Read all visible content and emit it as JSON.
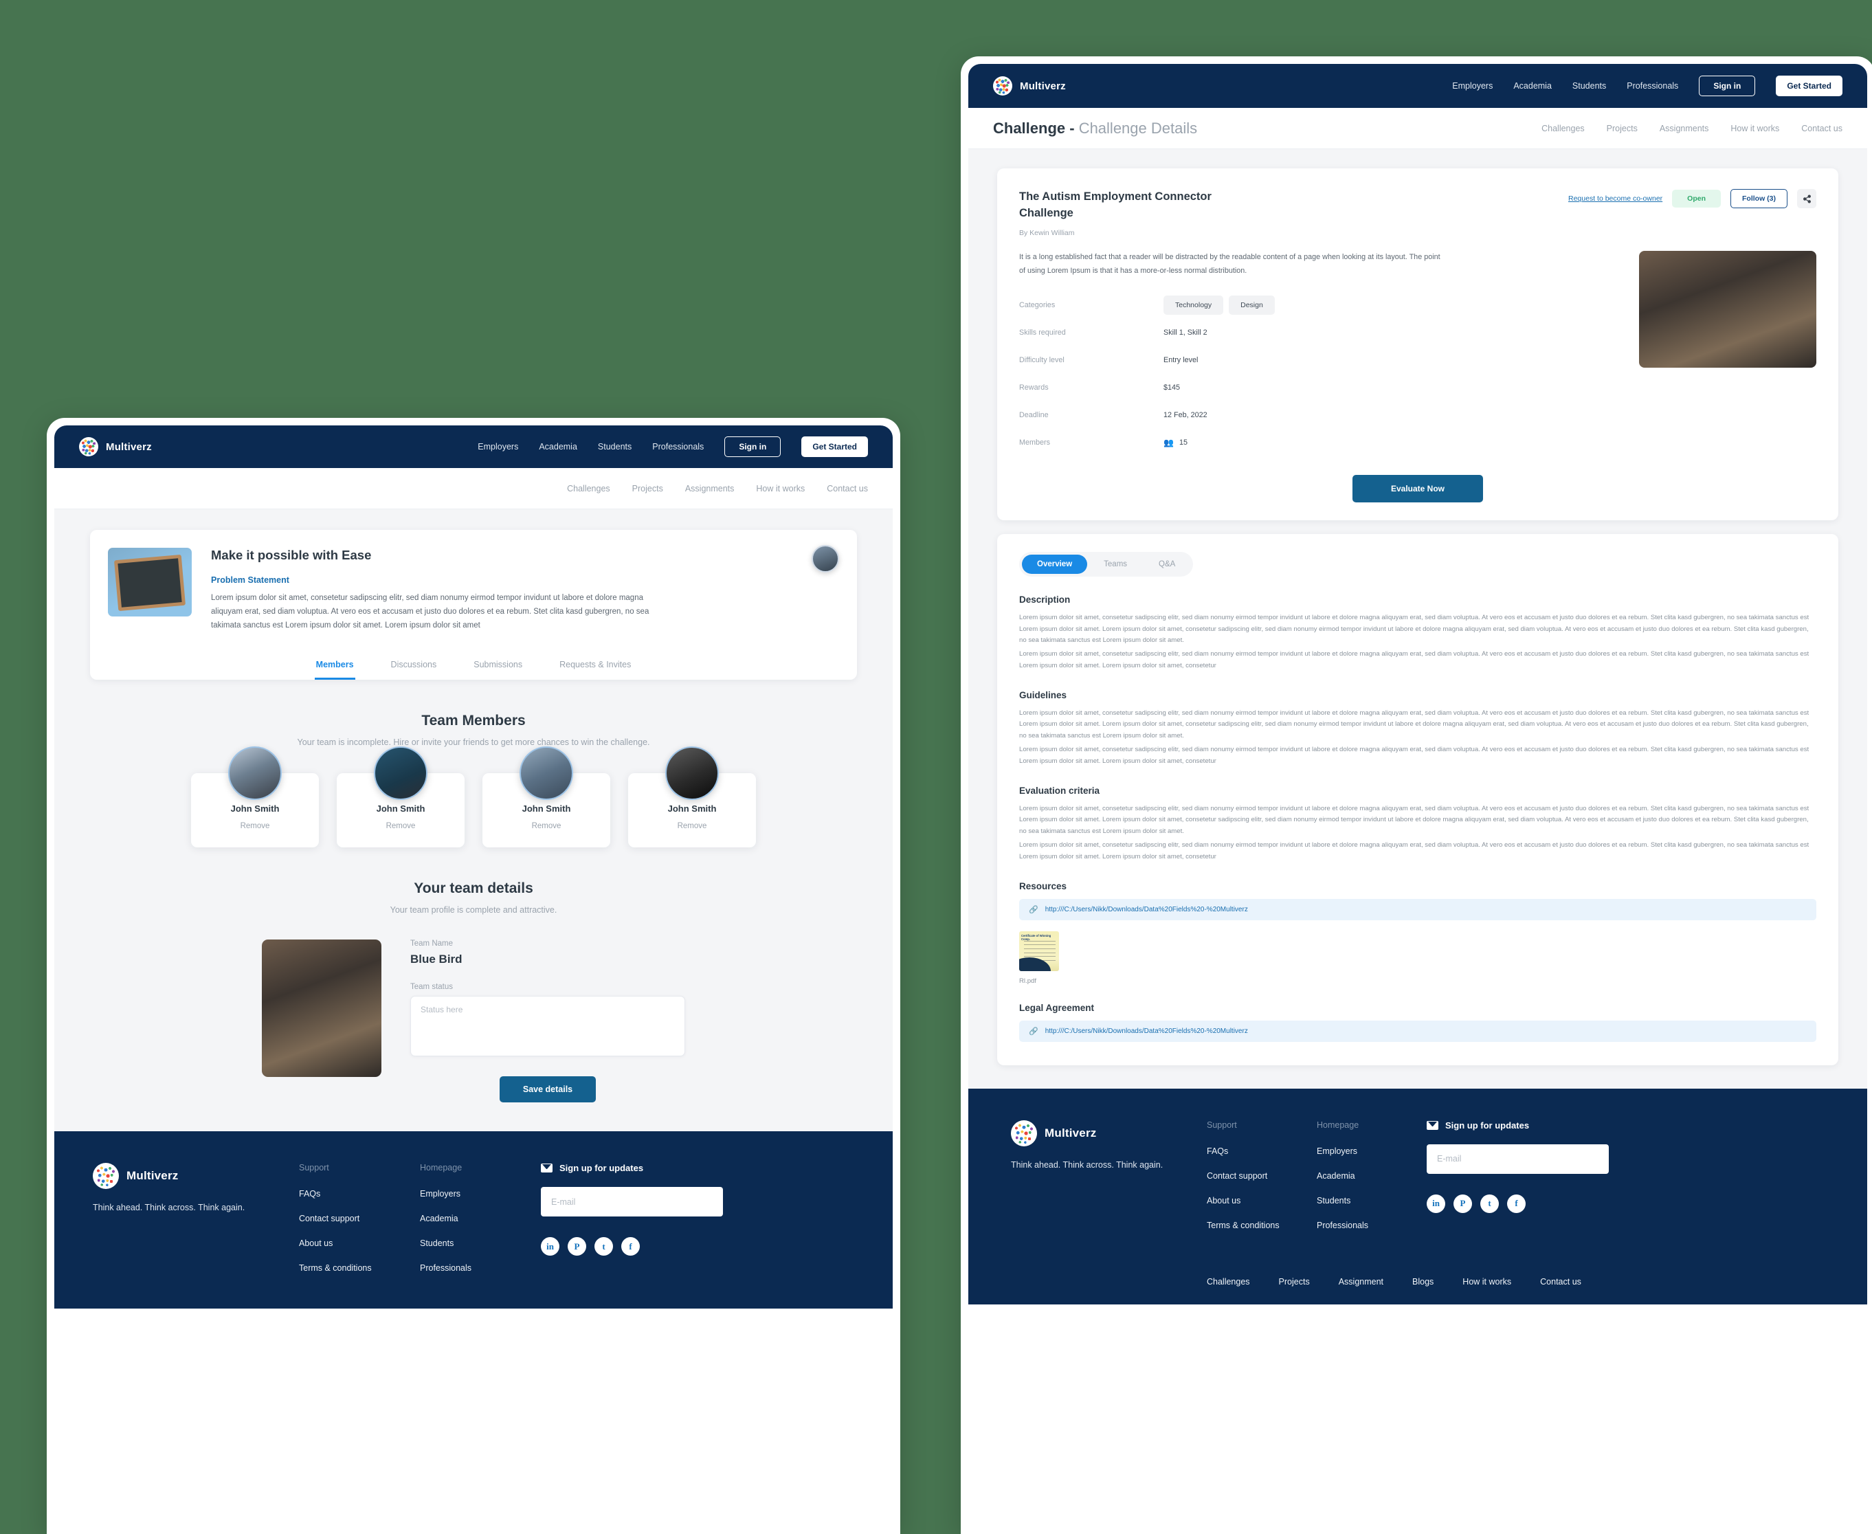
{
  "brand": {
    "name": "Multiverz",
    "tagline": "Think ahead. Think across. Think again."
  },
  "topnav": {
    "links": [
      "Employers",
      "Academia",
      "Students",
      "Professionals"
    ],
    "signin": "Sign in",
    "get_started": "Get Started"
  },
  "subnav": {
    "links": [
      "Challenges",
      "Projects",
      "Assignments",
      "How it works",
      "Contact us"
    ]
  },
  "left_panel": {
    "problem": {
      "title": "Make it possible with Ease",
      "label": "Problem Statement",
      "body": "Lorem ipsum dolor sit amet, consetetur sadipscing elitr, sed diam nonumy eirmod tempor invidunt ut labore et dolore magna aliquyam erat, sed diam voluptua. At vero eos et accusam et justo duo dolores et ea rebum. Stet clita kasd gubergren, no sea takimata sanctus est Lorem ipsum dolor sit amet. Lorem ipsum dolor sit amet",
      "image_alt": "chalkboard-possible"
    },
    "tabs": [
      {
        "label": "Members",
        "active": true
      },
      {
        "label": "Discussions",
        "active": false
      },
      {
        "label": "Submissions",
        "active": false
      },
      {
        "label": "Requests & Invites",
        "active": false
      }
    ],
    "team_members_section": {
      "heading": "Team Members",
      "subheading": "Your team is incomplete. Hire or invite your friends to get more chances to win the challenge.",
      "members": [
        {
          "name": "John Smith",
          "action": "Remove"
        },
        {
          "name": "John Smith",
          "action": "Remove"
        },
        {
          "name": "John Smith",
          "action": "Remove"
        },
        {
          "name": "John Smith",
          "action": "Remove"
        }
      ]
    },
    "team_details_section": {
      "heading": "Your team details",
      "subheading": "Your team profile is complete and attractive.",
      "team_name_label": "Team Name",
      "team_name": "Blue Bird",
      "team_status_label": "Team status",
      "team_status_placeholder": "Status here",
      "save_label": "Save details"
    }
  },
  "right_panel": {
    "page_title_strong": "Challenge - ",
    "page_title_muted": "Challenge Details",
    "detail": {
      "title": "The Autism Employment Connector Challenge",
      "by": "By Kewin William",
      "coowner_link": "Request to become co-owner",
      "status_badge": "Open",
      "follow_label": "Follow (3)",
      "share_icon": "share-icon",
      "description": "It is a long established fact that a reader will be distracted by the readable content of a page when looking at its layout. The point of using Lorem Ipsum is that it has a more-or-less normal distribution.",
      "meta": [
        {
          "key": "Categories",
          "chips": [
            "Technology",
            "Design"
          ]
        },
        {
          "key": "Skills required",
          "value": "Skill 1, Skill 2"
        },
        {
          "key": "Difficulty level",
          "value": "Entry level"
        },
        {
          "key": "Rewards",
          "value": "$145"
        },
        {
          "key": "Deadline",
          "value": "12 Feb, 2022"
        },
        {
          "key": "Members",
          "value": "15",
          "icon": "people-icon"
        }
      ],
      "evaluate_label": "Evaluate Now"
    },
    "content_tabs": [
      {
        "label": "Overview",
        "active": true
      },
      {
        "label": "Teams",
        "active": false
      },
      {
        "label": "Q&A",
        "active": false
      }
    ],
    "sections": {
      "description_title": "Description",
      "description_p1": "Lorem ipsum dolor sit amet, consetetur sadipscing elitr, sed diam nonumy eirmod tempor invidunt ut labore et dolore magna aliquyam erat, sed diam voluptua. At vero eos et accusam et justo duo dolores et ea rebum. Stet clita kasd gubergren, no sea takimata sanctus est Lorem ipsum dolor sit amet. Lorem ipsum dolor sit amet, consetetur sadipscing elitr, sed diam nonumy eirmod tempor invidunt ut labore et dolore magna aliquyam erat, sed diam voluptua. At vero eos et accusam et justo duo dolores et ea rebum. Stet clita kasd gubergren, no sea takimata sanctus est Lorem ipsum dolor sit amet.",
      "description_p2": "Lorem ipsum dolor sit amet, consetetur sadipscing elitr, sed diam nonumy eirmod tempor invidunt ut labore et dolore magna aliquyam erat, sed diam voluptua. At vero eos et accusam et justo duo dolores et ea rebum. Stet clita kasd gubergren, no sea takimata sanctus est Lorem ipsum dolor sit amet. Lorem ipsum dolor sit amet, consetetur",
      "guidelines_title": "Guidelines",
      "guidelines_p1": "Lorem ipsum dolor sit amet, consetetur sadipscing elitr, sed diam nonumy eirmod tempor invidunt ut labore et dolore magna aliquyam erat, sed diam voluptua. At vero eos et accusam et justo duo dolores et ea rebum. Stet clita kasd gubergren, no sea takimata sanctus est Lorem ipsum dolor sit amet. Lorem ipsum dolor sit amet, consetetur sadipscing elitr, sed diam nonumy eirmod tempor invidunt ut labore et dolore magna aliquyam erat, sed diam voluptua. At vero eos et accusam et justo duo dolores et ea rebum. Stet clita kasd gubergren, no sea takimata sanctus est Lorem ipsum dolor sit amet.",
      "guidelines_p2": "Lorem ipsum dolor sit amet, consetetur sadipscing elitr, sed diam nonumy eirmod tempor invidunt ut labore et dolore magna aliquyam erat, sed diam voluptua. At vero eos et accusam et justo duo dolores et ea rebum. Stet clita kasd gubergren, no sea takimata sanctus est Lorem ipsum dolor sit amet. Lorem ipsum dolor sit amet, consetetur",
      "evaluation_title": "Evaluation criteria",
      "evaluation_p1": "Lorem ipsum dolor sit amet, consetetur sadipscing elitr, sed diam nonumy eirmod tempor invidunt ut labore et dolore magna aliquyam erat, sed diam voluptua. At vero eos et accusam et justo duo dolores et ea rebum. Stet clita kasd gubergren, no sea takimata sanctus est Lorem ipsum dolor sit amet. Lorem ipsum dolor sit amet, consetetur sadipscing elitr, sed diam nonumy eirmod tempor invidunt ut labore et dolore magna aliquyam erat, sed diam voluptua. At vero eos et accusam et justo duo dolores et ea rebum. Stet clita kasd gubergren, no sea takimata sanctus est Lorem ipsum dolor sit amet.",
      "evaluation_p2": "Lorem ipsum dolor sit amet, consetetur sadipscing elitr, sed diam nonumy eirmod tempor invidunt ut labore et dolore magna aliquyam erat, sed diam voluptua. At vero eos et accusam et justo duo dolores et ea rebum. Stet clita kasd gubergren, no sea takimata sanctus est Lorem ipsum dolor sit amet. Lorem ipsum dolor sit amet, consetetur",
      "resources_title": "Resources",
      "resources_link": "http:///C:/Users/Nikk/Downloads/Data%20Fields%20-%20Multiverz",
      "resource_file_name": "Rl.pdf",
      "resource_thumb_title": "Certificate of Winning Comp.",
      "legal_title": "Legal Agreement",
      "legal_link": "http:///C:/Users/Nikk/Downloads/Data%20Fields%20-%20Multiverz"
    }
  },
  "footer": {
    "support_title": "Support",
    "support_links": [
      "FAQs",
      "Contact support",
      "About us",
      "Terms & conditions"
    ],
    "homepage_title": "Homepage",
    "homepage_links": [
      "Employers",
      "Academia",
      "Students",
      "Professionals"
    ],
    "signup_label": "Sign up for updates",
    "email_placeholder": "E-mail",
    "socials": [
      "in",
      "P",
      "t",
      "f"
    ],
    "bottom_links": [
      "Challenges",
      "Projects",
      "Assignment",
      "Blogs",
      "How it works",
      "Contact us"
    ]
  },
  "colors": {
    "page_background": "#477450",
    "navy": "#0b2a52",
    "accent_blue": "#1a8ae5",
    "button_blue": "#14618f",
    "status_green": "#2fa96b",
    "status_green_bg": "#e3f7ec"
  }
}
